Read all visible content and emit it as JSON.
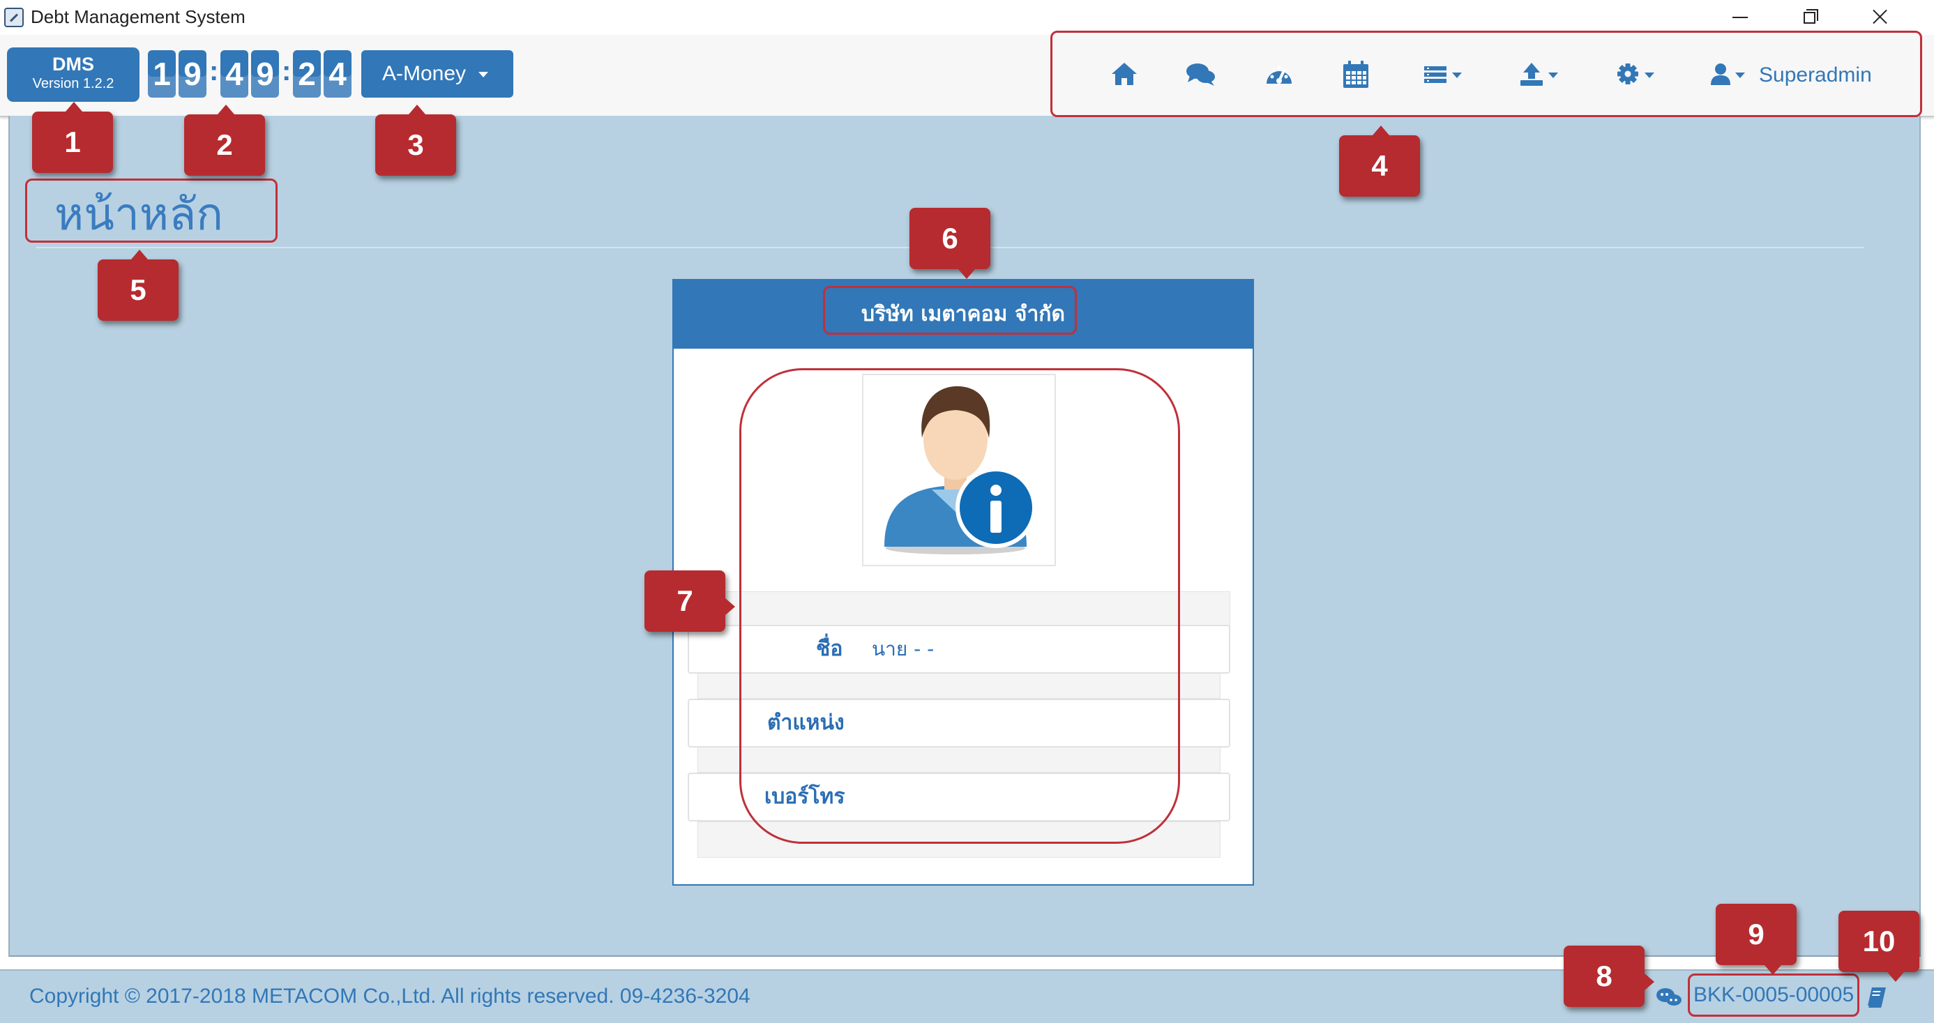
{
  "window": {
    "title": "Debt Management System"
  },
  "brand": {
    "name": "DMS",
    "version": "Version 1.2.2"
  },
  "clock": {
    "digits": [
      "1",
      "9",
      "4",
      "9",
      "2",
      "4"
    ],
    "separator": ":"
  },
  "company_dropdown": {
    "label": "A-Money"
  },
  "nav": {
    "icons": [
      "home-icon",
      "comments-icon",
      "dashboard-icon",
      "calendar-icon",
      "list-icon",
      "upload-icon",
      "gear-icon",
      "user-icon"
    ],
    "user_label": "Superadmin"
  },
  "page": {
    "title": "หน้าหลัก"
  },
  "profile_card": {
    "company_name": "บริษัท เมตาคอม จำกัด",
    "fields": [
      {
        "label": "ชื่อ",
        "value": "นาย - -"
      },
      {
        "label": "ตำแหน่ง",
        "value": ""
      },
      {
        "label": "เบอร์โทร",
        "value": ""
      }
    ]
  },
  "footer": {
    "copyright": "Copyright © 2017-2018 METACOM Co.,Ltd. All rights reserved. 09-4236-3204",
    "branch_code": "BKK-0005-00005"
  },
  "annotations": [
    "1",
    "2",
    "3",
    "4",
    "5",
    "6",
    "7",
    "8",
    "9",
    "10"
  ],
  "colors": {
    "primary": "#3277b7",
    "background": "#b7d1e2",
    "annotation": "#b62b2f"
  }
}
